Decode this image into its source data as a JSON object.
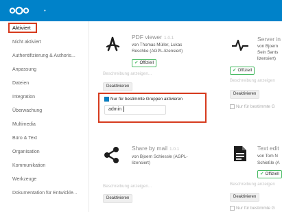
{
  "colors": {
    "brand": "#0082c9",
    "official": "#46ba61",
    "highlight": "#d63a1d"
  },
  "header": {
    "logo_icon": "nextcloud-logo-icon",
    "menu_icon": "more-dots-icon"
  },
  "sidebar": {
    "items": [
      {
        "label": "Aktiviert",
        "active": true
      },
      {
        "label": "Nicht aktiviert"
      },
      {
        "label": "Authentifizierung & Authoris..."
      },
      {
        "label": "Anpassung"
      },
      {
        "label": "Dateien"
      },
      {
        "label": "Integration"
      },
      {
        "label": "Überwachung"
      },
      {
        "label": "Multimedia"
      },
      {
        "label": "Büro & Text"
      },
      {
        "label": "Organisation"
      },
      {
        "label": "Kommunikation"
      },
      {
        "label": "Werkzeuge"
      },
      {
        "label": "Dokumentation für Entwickle..."
      }
    ]
  },
  "apps": [
    {
      "name": "PDF viewer",
      "version": "1.0.1",
      "author_line": "von Thomas Müller, Lukas",
      "author_line2": "Reschke (AGPL-lizensiert)",
      "badge": "Offiziell",
      "description_link": "Beschreibung anzeigen...",
      "action": "Deaktivieren",
      "groups_label": "Nur für bestimmte Gruppen aktivieren",
      "groups_value": "admin",
      "icon": "pdf-icon"
    },
    {
      "name": "Server in",
      "author_line": "von Bjoern",
      "author_line2": "Sein Sants",
      "author_line3": "lizensiert)",
      "badge": "Offiziell",
      "description_link": "Beschreibung anzeigen",
      "action": "Deaktivieren",
      "groups_label": "Nur für bestimmte G",
      "icon": "activity-pulse-icon"
    },
    {
      "name": "Share by mail",
      "version": "1.0.1",
      "author_line": "von Bjoern Schiessle (AGPL-",
      "author_line2": "lizensiert)",
      "badge": "Offiziell",
      "description_link": "Beschreibung anzeigen...",
      "action": "Deaktivieren",
      "icon": "share-icon"
    },
    {
      "name": "Text edit",
      "author_line": "von Tom N",
      "author_line2": "Schießle (A",
      "badge": "Offiziell",
      "description_link": "Beschreibung anzeigen",
      "action": "Deaktivieren",
      "groups_label": "Nur für bestimmte G",
      "icon": "text-document-icon"
    }
  ]
}
